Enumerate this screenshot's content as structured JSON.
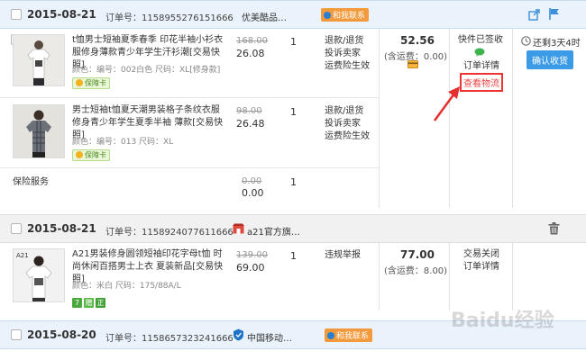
{
  "orders": [
    {
      "date": "2015-08-21",
      "order_no_label": "订单号：",
      "order_no": "1158955276151666",
      "shop": "优美酷品…",
      "contact": "和我联系",
      "items": [
        {
          "title": "t恤男士短袖夏季春季 印花半袖小衫衣服修身薄款青少年学生汗衫潮[交易快照]",
          "meta": "颜色：编号：002白色   尺码：XL[修身款]",
          "badge": "保障卡",
          "orig_price": "168.00",
          "price": "26.08",
          "qty": "1",
          "services": [
            "退款/退货",
            "投诉卖家",
            "运费险生效"
          ]
        },
        {
          "title": "男士短袖t恤夏天潮男装格子条纹衣服修身青少年学生夏季半袖 薄款[交易快照]",
          "meta": "颜色：编号：013   尺码：XL",
          "badge": "保障卡",
          "orig_price": "98.00",
          "price": "26.48",
          "qty": "1",
          "services": [
            "退款/退货",
            "投诉卖家",
            "运费险生效"
          ]
        }
      ],
      "insurance_label": "保险服务",
      "insurance_orig": "0.00",
      "insurance_price": "0.00",
      "insurance_qty": "1",
      "total": "52.56",
      "shipping": "(含运费：0.00)",
      "status": "快件已签收",
      "detail": "订单详情",
      "logistics": "查看物流",
      "countdown": "还剩3天4时",
      "confirm": "确认收货"
    },
    {
      "date": "2015-08-21",
      "order_no_label": "订单号：",
      "order_no": "1158924077611666",
      "shop": "a21官方旗…",
      "items": [
        {
          "title": "A21男装修身圆领短袖印花字母t恤 时尚休闲百搭男士上衣 夏装新品[交易快照]",
          "meta": "颜色：米白   尺码：175/88A/L",
          "badges": [
            "7",
            "赠",
            "正"
          ],
          "orig_price": "139.00",
          "price": "69.00",
          "qty": "1",
          "services": [
            "违规举报"
          ]
        }
      ],
      "total": "77.00",
      "shipping": "(含运费：8.00)",
      "status": "交易关闭",
      "detail": "订单详情"
    },
    {
      "date": "2015-08-20",
      "order_no_label": "订单号：",
      "order_no": "1158657323241666",
      "shop": "中国移动…",
      "contact": "和我联系"
    }
  ],
  "watermark": "Baidu经验"
}
